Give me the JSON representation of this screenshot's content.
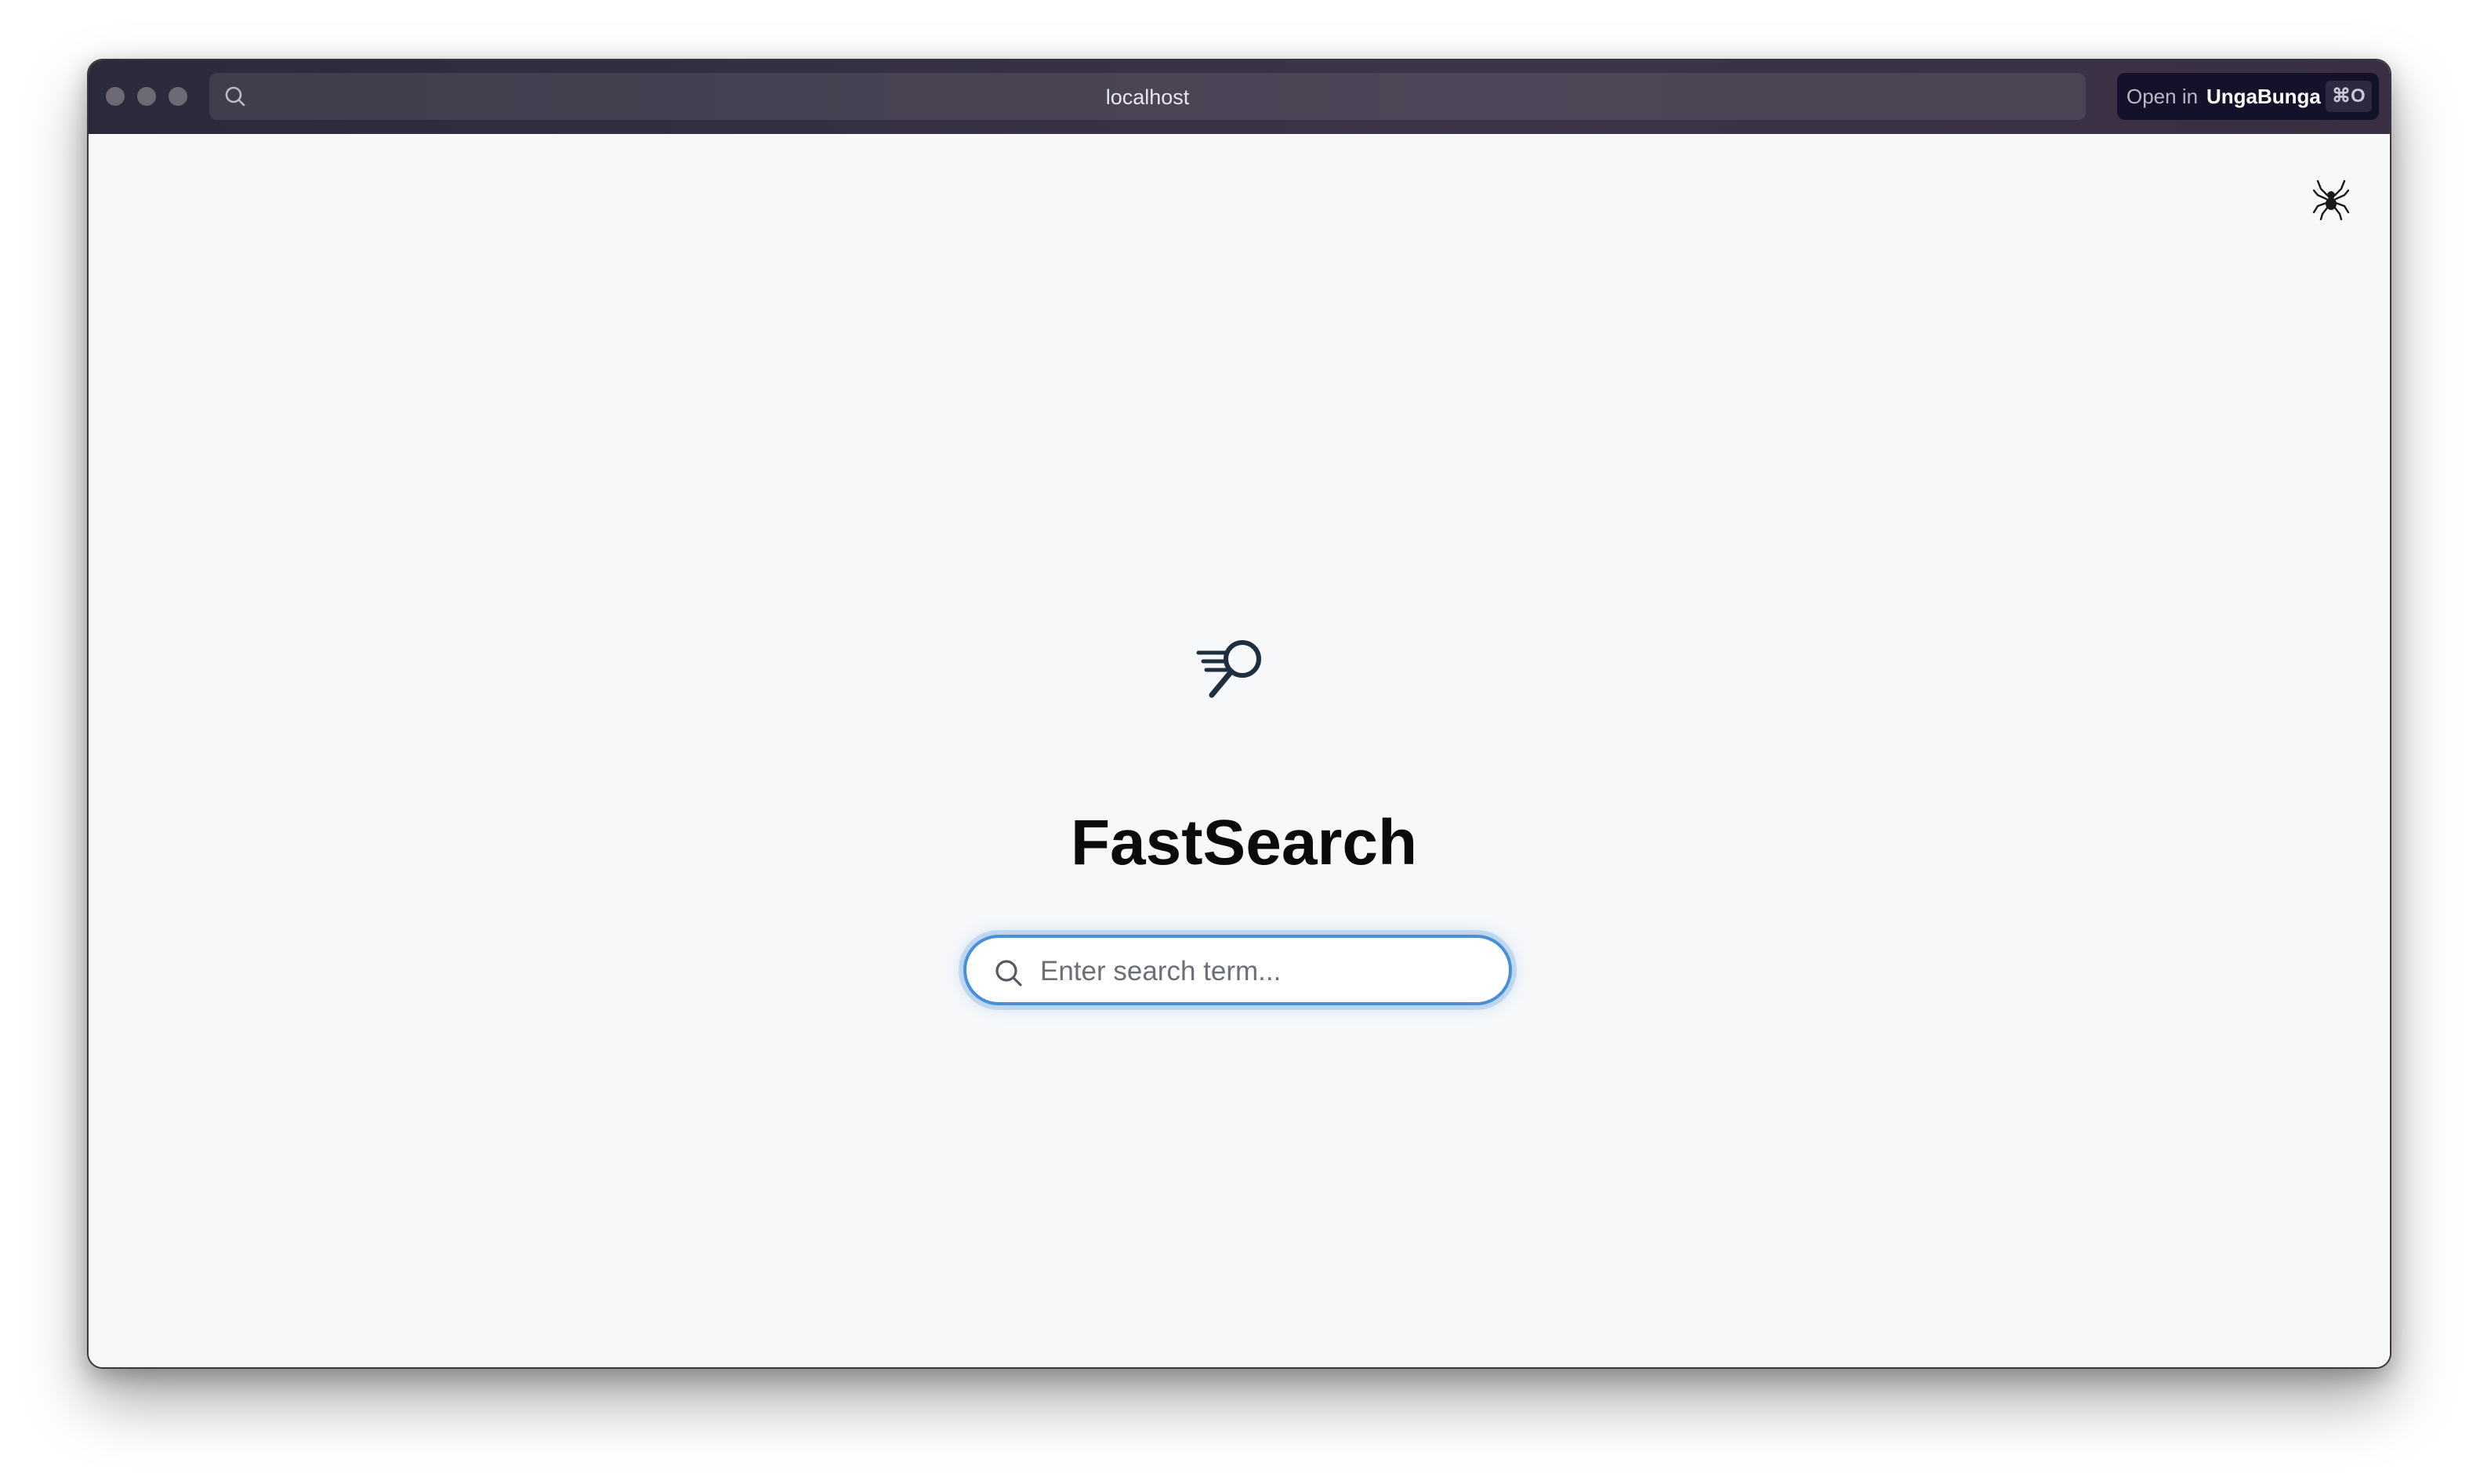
{
  "browser": {
    "url": "localhost",
    "open_in_prefix": "Open in",
    "open_in_app": "UngaBunga",
    "open_in_shortcut": "⌘O"
  },
  "page": {
    "title": "FastSearch",
    "search_placeholder": "Enter search term..."
  },
  "icons": {
    "top_right": "spider-icon",
    "logo": "fast-search-logo-icon"
  },
  "colors": {
    "accent": "#4a90d9",
    "background": "#f6f8fa",
    "title_text": "#0b0b0b"
  }
}
